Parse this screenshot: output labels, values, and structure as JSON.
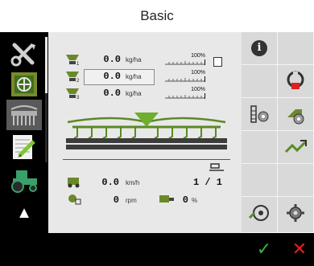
{
  "page": {
    "title": "Basic"
  },
  "left_nav": {
    "items": [
      {
        "name": "tools-icon"
      },
      {
        "name": "tractor-steering-icon"
      },
      {
        "name": "seeder-icon"
      },
      {
        "name": "notepad-edit-icon"
      },
      {
        "name": "tractor-icon"
      }
    ],
    "up_arrow": "▲",
    "down_arrow": "▼"
  },
  "metering": {
    "rows": [
      {
        "value": "0.0",
        "unit": "kg/ha",
        "percent": "100%"
      },
      {
        "value": "0.0",
        "unit": "kg/ha",
        "percent": "100%"
      },
      {
        "value": "0.0",
        "unit": "kg/ha",
        "percent": "100%"
      }
    ]
  },
  "status": {
    "speed_value": "0.0",
    "speed_unit": "km/h",
    "section_count": "1 / 1",
    "rpm_value": "0",
    "rpm_unit": "rpm",
    "percent_value": "0",
    "percent_unit": "%"
  },
  "right_panel": {
    "info_glyph": "i"
  },
  "bottom_bar": {
    "confirm_glyph": "✓",
    "cancel_glyph": "✕"
  },
  "colors": {
    "accent_green": "#5a8a24",
    "confirm_green": "#3cb043",
    "cancel_red": "#e02020",
    "panel_bg": "#e8e8e8"
  }
}
